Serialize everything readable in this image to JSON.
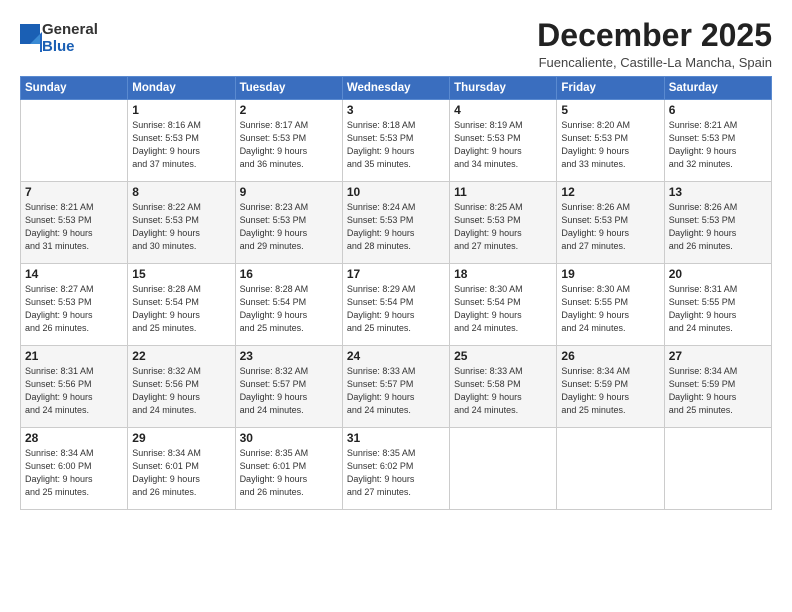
{
  "header": {
    "logo": {
      "general": "General",
      "blue": "Blue"
    },
    "title": "December 2025",
    "location": "Fuencaliente, Castille-La Mancha, Spain"
  },
  "weekdays": [
    "Sunday",
    "Monday",
    "Tuesday",
    "Wednesday",
    "Thursday",
    "Friday",
    "Saturday"
  ],
  "weeks": [
    [
      {
        "day": "",
        "empty": true
      },
      {
        "day": "1",
        "sunrise": "Sunrise: 8:16 AM",
        "sunset": "Sunset: 5:53 PM",
        "daylight": "Daylight: 9 hours",
        "daylight2": "and 37 minutes."
      },
      {
        "day": "2",
        "sunrise": "Sunrise: 8:17 AM",
        "sunset": "Sunset: 5:53 PM",
        "daylight": "Daylight: 9 hours",
        "daylight2": "and 36 minutes."
      },
      {
        "day": "3",
        "sunrise": "Sunrise: 8:18 AM",
        "sunset": "Sunset: 5:53 PM",
        "daylight": "Daylight: 9 hours",
        "daylight2": "and 35 minutes."
      },
      {
        "day": "4",
        "sunrise": "Sunrise: 8:19 AM",
        "sunset": "Sunset: 5:53 PM",
        "daylight": "Daylight: 9 hours",
        "daylight2": "and 34 minutes."
      },
      {
        "day": "5",
        "sunrise": "Sunrise: 8:20 AM",
        "sunset": "Sunset: 5:53 PM",
        "daylight": "Daylight: 9 hours",
        "daylight2": "and 33 minutes."
      },
      {
        "day": "6",
        "sunrise": "Sunrise: 8:21 AM",
        "sunset": "Sunset: 5:53 PM",
        "daylight": "Daylight: 9 hours",
        "daylight2": "and 32 minutes."
      }
    ],
    [
      {
        "day": "7",
        "sunrise": "Sunrise: 8:21 AM",
        "sunset": "Sunset: 5:53 PM",
        "daylight": "Daylight: 9 hours",
        "daylight2": "and 31 minutes."
      },
      {
        "day": "8",
        "sunrise": "Sunrise: 8:22 AM",
        "sunset": "Sunset: 5:53 PM",
        "daylight": "Daylight: 9 hours",
        "daylight2": "and 30 minutes."
      },
      {
        "day": "9",
        "sunrise": "Sunrise: 8:23 AM",
        "sunset": "Sunset: 5:53 PM",
        "daylight": "Daylight: 9 hours",
        "daylight2": "and 29 minutes."
      },
      {
        "day": "10",
        "sunrise": "Sunrise: 8:24 AM",
        "sunset": "Sunset: 5:53 PM",
        "daylight": "Daylight: 9 hours",
        "daylight2": "and 28 minutes."
      },
      {
        "day": "11",
        "sunrise": "Sunrise: 8:25 AM",
        "sunset": "Sunset: 5:53 PM",
        "daylight": "Daylight: 9 hours",
        "daylight2": "and 27 minutes."
      },
      {
        "day": "12",
        "sunrise": "Sunrise: 8:26 AM",
        "sunset": "Sunset: 5:53 PM",
        "daylight": "Daylight: 9 hours",
        "daylight2": "and 27 minutes."
      },
      {
        "day": "13",
        "sunrise": "Sunrise: 8:26 AM",
        "sunset": "Sunset: 5:53 PM",
        "daylight": "Daylight: 9 hours",
        "daylight2": "and 26 minutes."
      }
    ],
    [
      {
        "day": "14",
        "sunrise": "Sunrise: 8:27 AM",
        "sunset": "Sunset: 5:53 PM",
        "daylight": "Daylight: 9 hours",
        "daylight2": "and 26 minutes."
      },
      {
        "day": "15",
        "sunrise": "Sunrise: 8:28 AM",
        "sunset": "Sunset: 5:54 PM",
        "daylight": "Daylight: 9 hours",
        "daylight2": "and 25 minutes."
      },
      {
        "day": "16",
        "sunrise": "Sunrise: 8:28 AM",
        "sunset": "Sunset: 5:54 PM",
        "daylight": "Daylight: 9 hours",
        "daylight2": "and 25 minutes."
      },
      {
        "day": "17",
        "sunrise": "Sunrise: 8:29 AM",
        "sunset": "Sunset: 5:54 PM",
        "daylight": "Daylight: 9 hours",
        "daylight2": "and 25 minutes."
      },
      {
        "day": "18",
        "sunrise": "Sunrise: 8:30 AM",
        "sunset": "Sunset: 5:54 PM",
        "daylight": "Daylight: 9 hours",
        "daylight2": "and 24 minutes."
      },
      {
        "day": "19",
        "sunrise": "Sunrise: 8:30 AM",
        "sunset": "Sunset: 5:55 PM",
        "daylight": "Daylight: 9 hours",
        "daylight2": "and 24 minutes."
      },
      {
        "day": "20",
        "sunrise": "Sunrise: 8:31 AM",
        "sunset": "Sunset: 5:55 PM",
        "daylight": "Daylight: 9 hours",
        "daylight2": "and 24 minutes."
      }
    ],
    [
      {
        "day": "21",
        "sunrise": "Sunrise: 8:31 AM",
        "sunset": "Sunset: 5:56 PM",
        "daylight": "Daylight: 9 hours",
        "daylight2": "and 24 minutes."
      },
      {
        "day": "22",
        "sunrise": "Sunrise: 8:32 AM",
        "sunset": "Sunset: 5:56 PM",
        "daylight": "Daylight: 9 hours",
        "daylight2": "and 24 minutes."
      },
      {
        "day": "23",
        "sunrise": "Sunrise: 8:32 AM",
        "sunset": "Sunset: 5:57 PM",
        "daylight": "Daylight: 9 hours",
        "daylight2": "and 24 minutes."
      },
      {
        "day": "24",
        "sunrise": "Sunrise: 8:33 AM",
        "sunset": "Sunset: 5:57 PM",
        "daylight": "Daylight: 9 hours",
        "daylight2": "and 24 minutes."
      },
      {
        "day": "25",
        "sunrise": "Sunrise: 8:33 AM",
        "sunset": "Sunset: 5:58 PM",
        "daylight": "Daylight: 9 hours",
        "daylight2": "and 24 minutes."
      },
      {
        "day": "26",
        "sunrise": "Sunrise: 8:34 AM",
        "sunset": "Sunset: 5:59 PM",
        "daylight": "Daylight: 9 hours",
        "daylight2": "and 25 minutes."
      },
      {
        "day": "27",
        "sunrise": "Sunrise: 8:34 AM",
        "sunset": "Sunset: 5:59 PM",
        "daylight": "Daylight: 9 hours",
        "daylight2": "and 25 minutes."
      }
    ],
    [
      {
        "day": "28",
        "sunrise": "Sunrise: 8:34 AM",
        "sunset": "Sunset: 6:00 PM",
        "daylight": "Daylight: 9 hours",
        "daylight2": "and 25 minutes."
      },
      {
        "day": "29",
        "sunrise": "Sunrise: 8:34 AM",
        "sunset": "Sunset: 6:01 PM",
        "daylight": "Daylight: 9 hours",
        "daylight2": "and 26 minutes."
      },
      {
        "day": "30",
        "sunrise": "Sunrise: 8:35 AM",
        "sunset": "Sunset: 6:01 PM",
        "daylight": "Daylight: 9 hours",
        "daylight2": "and 26 minutes."
      },
      {
        "day": "31",
        "sunrise": "Sunrise: 8:35 AM",
        "sunset": "Sunset: 6:02 PM",
        "daylight": "Daylight: 9 hours",
        "daylight2": "and 27 minutes."
      },
      {
        "day": "",
        "empty": true
      },
      {
        "day": "",
        "empty": true
      },
      {
        "day": "",
        "empty": true
      }
    ]
  ]
}
